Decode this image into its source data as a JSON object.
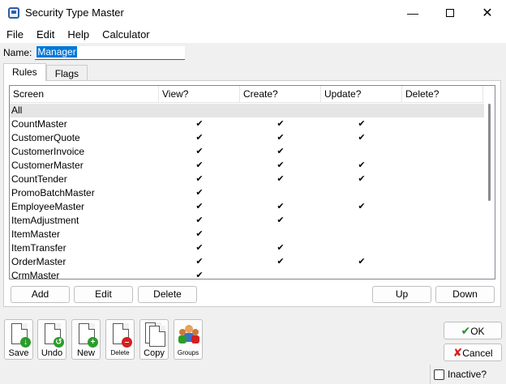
{
  "window": {
    "title": "Security Type Master"
  },
  "menu": {
    "items": [
      "File",
      "Edit",
      "Help",
      "Calculator"
    ]
  },
  "name_field": {
    "label": "Name:",
    "value": "Manager"
  },
  "tabs": [
    "Rules",
    "Flags"
  ],
  "grid": {
    "columns": [
      "Screen",
      "View?",
      "Create?",
      "Update?",
      "Delete?"
    ],
    "check_glyph": "✔",
    "rows": [
      {
        "screen": "All",
        "view": false,
        "create": false,
        "update": false,
        "delete": false
      },
      {
        "screen": "CountMaster",
        "view": true,
        "create": true,
        "update": true,
        "delete": false
      },
      {
        "screen": "CustomerQuote",
        "view": true,
        "create": true,
        "update": true,
        "delete": false
      },
      {
        "screen": "CustomerInvoice",
        "view": true,
        "create": true,
        "update": false,
        "delete": false
      },
      {
        "screen": "CustomerMaster",
        "view": true,
        "create": true,
        "update": true,
        "delete": false
      },
      {
        "screen": "CountTender",
        "view": true,
        "create": true,
        "update": true,
        "delete": false
      },
      {
        "screen": "PromoBatchMaster",
        "view": true,
        "create": false,
        "update": false,
        "delete": false
      },
      {
        "screen": "EmployeeMaster",
        "view": true,
        "create": true,
        "update": true,
        "delete": false
      },
      {
        "screen": "ItemAdjustment",
        "view": true,
        "create": true,
        "update": false,
        "delete": false
      },
      {
        "screen": "ItemMaster",
        "view": true,
        "create": false,
        "update": false,
        "delete": false
      },
      {
        "screen": "ItemTransfer",
        "view": true,
        "create": true,
        "update": false,
        "delete": false
      },
      {
        "screen": "OrderMaster",
        "view": true,
        "create": true,
        "update": true,
        "delete": false
      },
      {
        "screen": "CrmMaster",
        "view": true,
        "create": false,
        "update": false,
        "delete": false
      }
    ]
  },
  "grid_buttons": {
    "add": "Add",
    "edit": "Edit",
    "delete": "Delete",
    "up": "Up",
    "down": "Down"
  },
  "toolbar": {
    "save": "Save",
    "undo": "Undo",
    "new": "New",
    "delete": "Delete",
    "copy": "Copy",
    "groups": "Groups"
  },
  "dialog_buttons": {
    "ok": "OK",
    "cancel": "Cancel"
  },
  "inactive_label": "Inactive?",
  "colors": {
    "selection": "#0078d7",
    "ok_check": "#2e8b2e",
    "cancel_x": "#d42020",
    "add_badge": "#2a9d2a",
    "delete_badge": "#d42020"
  }
}
